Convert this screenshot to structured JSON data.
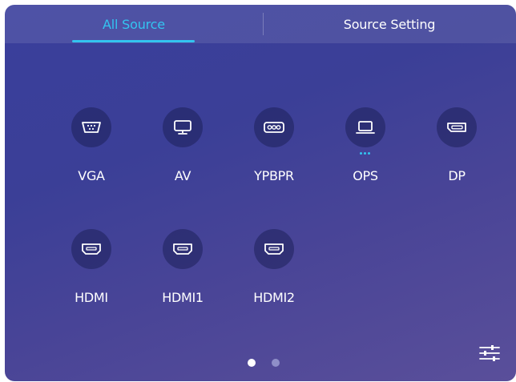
{
  "colors": {
    "accent": "#33c4f0",
    "text": "#ffffff",
    "tab_inactive": "#ffffff",
    "page_dot_active": "#ffffff",
    "page_dot_inactive": "#8f8fc8"
  },
  "tabs": {
    "all_source": "All Source",
    "source_setting": "Source Setting",
    "active": "all_source"
  },
  "sources": [
    {
      "label": "VGA",
      "icon": "vga-port-icon",
      "active": false
    },
    {
      "label": "AV",
      "icon": "monitor-icon",
      "active": false
    },
    {
      "label": "YPBPR",
      "icon": "component-port-icon",
      "active": false
    },
    {
      "label": "OPS",
      "icon": "laptop-icon",
      "active": true
    },
    {
      "label": "DP",
      "icon": "displayport-icon",
      "active": false
    },
    {
      "label": "HDMI",
      "icon": "hdmi-port-icon",
      "active": false
    },
    {
      "label": "HDMI1",
      "icon": "hdmi-port-icon",
      "active": false
    },
    {
      "label": "HDMI2",
      "icon": "hdmi-port-icon",
      "active": false
    }
  ],
  "pagination": {
    "page_count": 2,
    "current_page": 1
  },
  "settings_icon": "sliders-icon"
}
